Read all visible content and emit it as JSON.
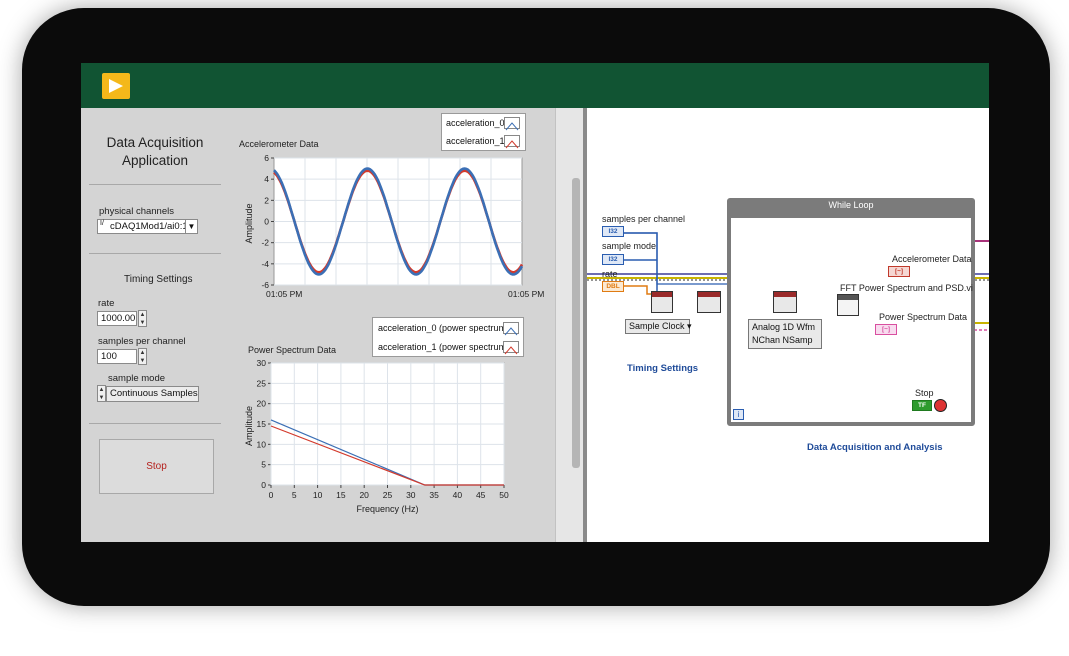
{
  "front_panel": {
    "app_title_line1": "Data Acquisition",
    "app_title_line2": "Application",
    "physical_channels_label": "physical channels",
    "physical_channels_value": "cDAQ1Mod1/ai0:1",
    "timing_settings_label": "Timing Settings",
    "rate_label": "rate",
    "rate_value": "1000.00",
    "samples_label": "samples per channel",
    "samples_value": "100",
    "sample_mode_label": "sample mode",
    "sample_mode_value": "Continuous Samples",
    "stop_label": "Stop"
  },
  "accel_graph": {
    "title": "Accelerometer Data",
    "legend": [
      "acceleration_0",
      "acceleration_1"
    ],
    "legend_colors": [
      "#3b6fb5",
      "#d33a2c"
    ]
  },
  "power_graph": {
    "title": "Power Spectrum Data",
    "legend": [
      "acceleration_0 (power spectrum)",
      "acceleration_1 (power spectrum)"
    ],
    "legend_colors": [
      "#3b6fb5",
      "#d33a2c"
    ]
  },
  "chart_data": [
    {
      "type": "line",
      "title": "Accelerometer Data",
      "xlabel": "",
      "ylabel": "Amplitude",
      "x_ticks": [
        "01:05 PM",
        "01:05 PM"
      ],
      "y_ticks": [
        6,
        4,
        2,
        0,
        -2,
        -4,
        -6
      ],
      "ylim": [
        -6,
        6
      ],
      "grid": true,
      "legend_position": "top-right",
      "series": [
        {
          "name": "acceleration_0",
          "color": "#3b6fb5",
          "waveform": "sine",
          "amplitude": 5,
          "cycles": 2.55
        },
        {
          "name": "acceleration_1",
          "color": "#d33a2c",
          "waveform": "sine",
          "amplitude": 4.8,
          "cycles": 2.55
        }
      ]
    },
    {
      "type": "line",
      "title": "Power Spectrum Data",
      "xlabel": "Frequency (Hz)",
      "ylabel": "Amplitude",
      "x_ticks": [
        0,
        5,
        10,
        15,
        20,
        25,
        30,
        35,
        40,
        45,
        50
      ],
      "y_ticks": [
        30,
        25,
        20,
        15,
        10,
        5,
        0
      ],
      "xlim": [
        0,
        50
      ],
      "ylim": [
        0,
        30
      ],
      "grid": true,
      "legend_position": "top-right",
      "series": [
        {
          "name": "acceleration_0 (power spectrum)",
          "color": "#3b6fb5",
          "x": [
            0,
            33,
            50
          ],
          "y": [
            16,
            0,
            0
          ]
        },
        {
          "name": "acceleration_1 (power spectrum)",
          "color": "#d33a2c",
          "x": [
            0,
            33,
            50
          ],
          "y": [
            14.5,
            0,
            0
          ]
        }
      ]
    }
  ],
  "block_diagram": {
    "samples_per_channel": "samples per channel",
    "sample_mode": "sample mode",
    "rate": "rate",
    "i32": "I32",
    "dbl": "DBL",
    "sample_clock": "Sample Clock",
    "timing_settings": "Timing Settings",
    "while_loop": "While Loop",
    "accelerometer_data": "Accelerometer Data",
    "fft_vi": "FFT Power Spectrum and PSD.vi",
    "power_spectrum_data": "Power Spectrum Data",
    "analog_line1": "Analog 1D Wfm",
    "analog_line2": "NChan NSamp",
    "stop": "Stop",
    "tf": "TF",
    "iteration": "i",
    "data_acq_analysis": "Data Acquisition and Analysis"
  }
}
